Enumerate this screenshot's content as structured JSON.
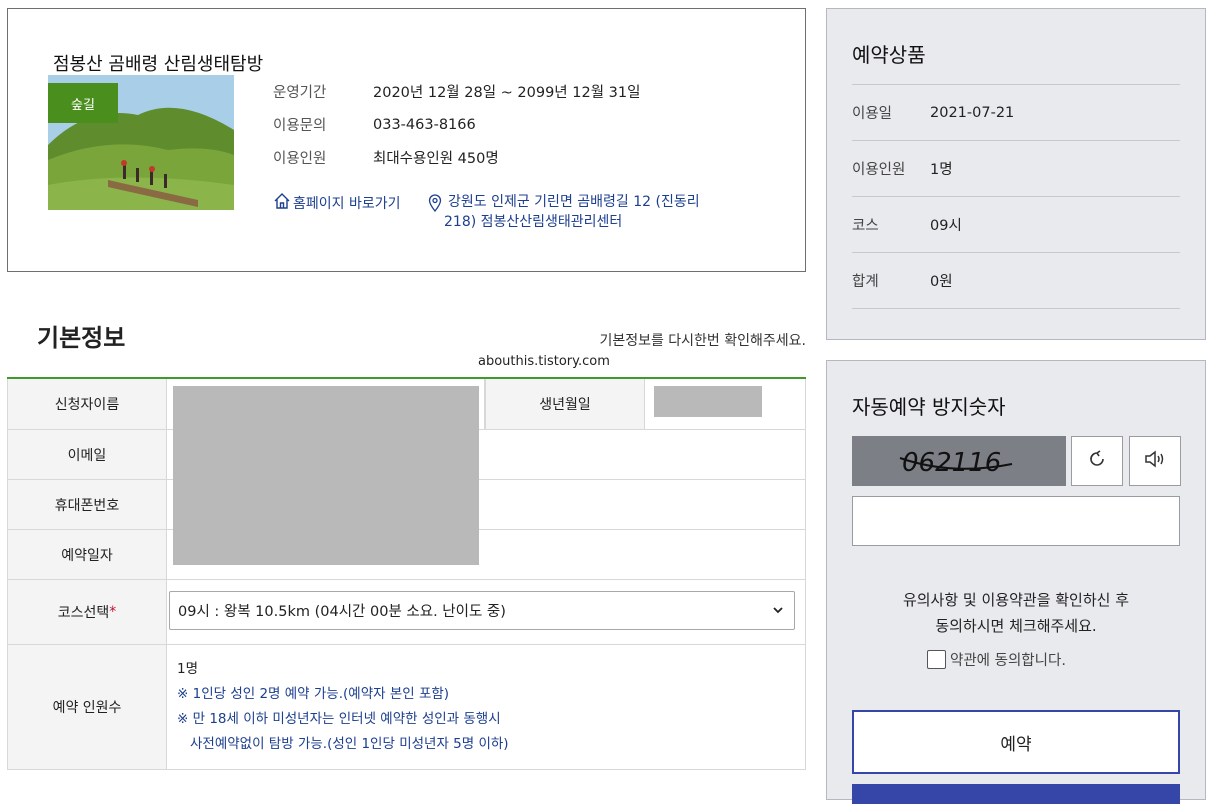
{
  "product": {
    "title": "점봉산 곰배령 산림생태탐방",
    "badge": "숲길",
    "info": [
      {
        "label": "운영기간",
        "value": "2020년 12월 28일 ~ 2099년 12월 31일"
      },
      {
        "label": "이용문의",
        "value": "033-463-8166"
      },
      {
        "label": "이용인원",
        "value": "최대수용인원 450명"
      }
    ],
    "homepage_link": "홈페이지 바로가기",
    "address_line1": "강원도 인제군 기린면 곰배령길 12 (진동리",
    "address_line2": "218) 점봉산산림생태관리센터"
  },
  "basic_info": {
    "title": "기본정보",
    "note": "기본정보를 다시한번 확인해주세요.",
    "watermark": "abouthis.tistory.com"
  },
  "form": {
    "applicant_name_label": "신청자이름",
    "birth_label": "생년월일",
    "email_label": "이메일",
    "phone_label": "휴대폰번호",
    "date_label": "예약일자",
    "course_label": "코스선택",
    "required_mark": "*",
    "course_value": "09시 : 왕복 10.5km (04시간 00분 소요. 난이도 중)",
    "people_label": "예약 인원수",
    "people_count": "1명",
    "people_note1": "※ 1인당 성인 2명 예약 가능.(예약자 본인 포함)",
    "people_note2": "※ 만 18세 이하 미성년자는 인터넷 예약한 성인과 동행시",
    "people_note3": "사전예약없이 탐방 가능.(성인 1인당 미성년자 5명 이하)"
  },
  "summary": {
    "title": "예약상품",
    "rows": [
      {
        "label": "이용일",
        "value": "2021-07-21"
      },
      {
        "label": "이용인원",
        "value": "1명"
      },
      {
        "label": "코스",
        "value": "09시"
      },
      {
        "label": "합계",
        "value": "0원"
      }
    ]
  },
  "captcha": {
    "title": "자동예약 방지숫자",
    "code": "062116",
    "agree_line1": "유의사항 및 이용약관을 확인하신 후",
    "agree_line2": "동의하시면 체크해주세요.",
    "agree_checkbox_label": "약관에 동의합니다.",
    "reserve_button": "예약"
  },
  "colors": {
    "accent_green": "#3f9a2a",
    "badge_green": "#4a8f1d",
    "link_blue": "#1d3f8f",
    "button_blue": "#3546a8",
    "panel_bg": "#e9eaee"
  },
  "icons": [
    "home-icon",
    "map-pin-icon",
    "refresh-icon",
    "speaker-icon",
    "chevron-down-icon"
  ]
}
